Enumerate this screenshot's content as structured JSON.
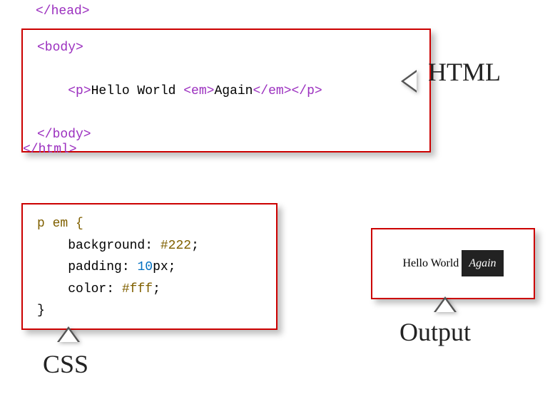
{
  "stray": {
    "head_close": "</head>",
    "html_close": "</html>"
  },
  "html_box": {
    "l1_body_open": "<body>",
    "l2_p_open": "<p>",
    "l2_text1": "Hello World ",
    "l2_em_open": "<em>",
    "l2_text2": "Again",
    "l2_em_close": "</em>",
    "l2_p_close": "</p>",
    "l3_body_close": "</body>"
  },
  "css_box": {
    "selector": "p em {",
    "prop1_name": "background",
    "prop1_sep": ": ",
    "prop1_val": "#222",
    "punct": ";",
    "prop2_name": "padding",
    "prop2_sepA": ": ",
    "prop2_num": "10",
    "prop2_unit": "px",
    "prop3_name": "color",
    "prop3_sep": ": ",
    "prop3_val": "#fff",
    "close": "}"
  },
  "output": {
    "text1": "Hello World ",
    "em": "Again"
  },
  "labels": {
    "html": "HTML",
    "css": "CSS",
    "output": "Output"
  }
}
